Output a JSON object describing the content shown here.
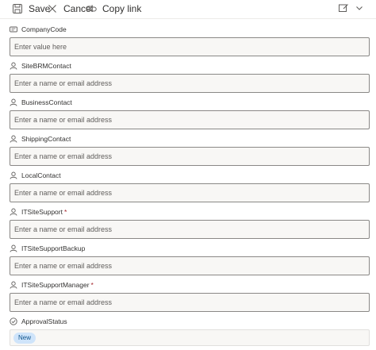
{
  "toolbar": {
    "save_label": "Save",
    "cancel_label": "Cancel",
    "copy_label": "Copy link"
  },
  "fields": [
    {
      "label": "CompanyCode",
      "icon": "text-field-icon",
      "placeholder": "Enter value here",
      "required": false
    },
    {
      "label": "SiteBRMContact",
      "icon": "person-icon",
      "placeholder": "Enter a name or email address",
      "required": false
    },
    {
      "label": "BusinessContact",
      "icon": "person-icon",
      "placeholder": "Enter a name or email address",
      "required": false
    },
    {
      "label": "ShippingContact",
      "icon": "person-icon",
      "placeholder": "Enter a name or email address",
      "required": false
    },
    {
      "label": "LocalContact",
      "icon": "person-icon",
      "placeholder": "Enter a name or email address",
      "required": false
    },
    {
      "label": "ITSiteSupport",
      "icon": "person-icon",
      "placeholder": "Enter a name or email address",
      "required": true
    },
    {
      "label": "ITSiteSupportBackup",
      "icon": "person-icon",
      "placeholder": "Enter a name or email address",
      "required": false
    },
    {
      "label": "ITSiteSupportManager",
      "icon": "person-icon",
      "placeholder": "Enter a name or email address",
      "required": true
    }
  ],
  "approval": {
    "label": "ApprovalStatus",
    "icon": "check-circle-icon",
    "value": "New"
  },
  "required_marker": "*",
  "colors": {
    "badge_bg": "#cfe4fa",
    "badge_text": "#0f548c",
    "input_bg": "#f8f7f5",
    "input_border": "#8a8886"
  }
}
